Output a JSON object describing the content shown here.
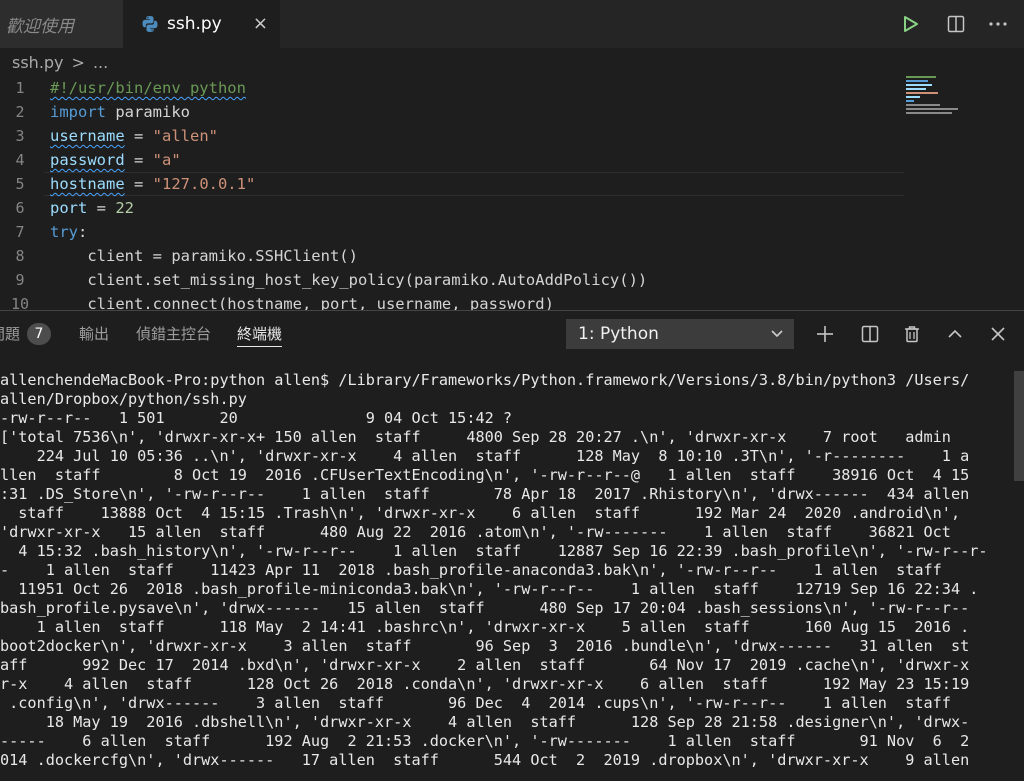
{
  "tabs": {
    "welcome_label": "歡迎使用",
    "active_label": "ssh.py",
    "close_symbol": "×"
  },
  "breadcrumb": {
    "file": "ssh.py",
    "separator": ">",
    "more": "..."
  },
  "editor": {
    "line_numbers": [
      "1",
      "2",
      "3",
      "4",
      "5",
      "6",
      "7",
      "8",
      "9",
      "10"
    ],
    "lines": [
      [
        {
          "t": "#!/usr/bin/env python",
          "c": "tk-comment",
          "s": true
        }
      ],
      [
        {
          "t": "import",
          "c": "tk-kw"
        },
        {
          "t": " paramiko",
          "c": ""
        }
      ],
      [
        {
          "t": "username",
          "c": "tk-var",
          "s": true
        },
        {
          "t": " = ",
          "c": ""
        },
        {
          "t": "\"allen\"",
          "c": "tk-str"
        }
      ],
      [
        {
          "t": "password",
          "c": "tk-var",
          "s": true
        },
        {
          "t": " = ",
          "c": ""
        },
        {
          "t": "\"a\"",
          "c": "tk-str"
        }
      ],
      [
        {
          "t": "hostname",
          "c": "tk-var",
          "s": true
        },
        {
          "t": " = ",
          "c": ""
        },
        {
          "t": "\"127.0.0.1\"",
          "c": "tk-str"
        }
      ],
      [
        {
          "t": "port",
          "c": "tk-var"
        },
        {
          "t": " = ",
          "c": ""
        },
        {
          "t": "22",
          "c": "tk-num"
        }
      ],
      [
        {
          "t": "try",
          "c": "tk-kw"
        },
        {
          "t": ":",
          "c": ""
        }
      ],
      [
        {
          "t": "    client = paramiko.SSHClient()",
          "c": ""
        }
      ],
      [
        {
          "t": "    client.set_missing_host_key_policy(paramiko.AutoAddPolicy())",
          "c": ""
        }
      ],
      [
        {
          "t": "    client.connect(hostname, port, username, password)",
          "c": ""
        }
      ]
    ]
  },
  "panel": {
    "problems_label": "問題",
    "problems_count": "7",
    "output_label": "輸出",
    "debug_console_label": "偵錯主控台",
    "terminal_label": "終端機",
    "terminal_select": "1: Python",
    "plus_symbol": "+",
    "close_symbol": "×"
  },
  "terminal": {
    "lines": [
      "allenchendeMacBook-Pro:python allen$ /Library/Frameworks/Python.framework/Versions/3.8/bin/python3 /Users/",
      "allen/Dropbox/python/ssh.py",
      "-rw-r--r--   1 501      20              9 04 Oct 15:42 ?",
      "['total 7536\\n', 'drwxr-xr-x+ 150 allen  staff     4800 Sep 28 20:27 .\\n', 'drwxr-xr-x    7 root   admin",
      "    224 Jul 10 05:36 ..\\n', 'drwxr-xr-x    4 allen  staff      128 May  8 10:10 .3T\\n', '-r--------    1 a",
      "llen  staff        8 Oct 19  2016 .CFUserTextEncoding\\n', '-rw-r--r--@   1 allen  staff    38916 Oct  4 15",
      ":31 .DS_Store\\n', '-rw-r--r--    1 allen  staff       78 Apr 18  2017 .Rhistory\\n', 'drwx------  434 allen",
      "  staff    13888 Oct  4 15:15 .Trash\\n', 'drwxr-xr-x    6 allen  staff      192 Mar 24  2020 .android\\n',",
      "'drwxr-xr-x   15 allen  staff      480 Aug 22  2016 .atom\\n', '-rw-------    1 allen  staff    36821 Oct",
      "  4 15:32 .bash_history\\n', '-rw-r--r--    1 allen  staff    12887 Sep 16 22:39 .bash_profile\\n', '-rw-r--r-",
      "-    1 allen  staff    11423 Apr 11  2018 .bash_profile-anaconda3.bak\\n', '-rw-r--r--    1 allen  staff",
      "  11951 Oct 26  2018 .bash_profile-miniconda3.bak\\n', '-rw-r--r--    1 allen  staff    12719 Sep 16 22:34 .",
      "bash_profile.pysave\\n', 'drwx------   15 allen  staff      480 Sep 17 20:04 .bash_sessions\\n', '-rw-r--r--",
      "    1 allen  staff      118 May  2 14:41 .bashrc\\n', 'drwxr-xr-x    5 allen  staff      160 Aug 15  2016 .",
      "boot2docker\\n', 'drwxr-xr-x    3 allen  staff       96 Sep  3  2016 .bundle\\n', 'drwx------   31 allen  st",
      "aff      992 Dec 17  2014 .bxd\\n', 'drwxr-xr-x    2 allen  staff       64 Nov 17  2019 .cache\\n', 'drwxr-x",
      "r-x    4 allen  staff      128 Oct 26  2018 .conda\\n', 'drwxr-xr-x    6 allen  staff      192 May 23 15:19",
      " .config\\n', 'drwx------    3 allen  staff       96 Dec  4  2014 .cups\\n', '-rw-r--r--    1 allen  staff",
      "     18 May 19  2016 .dbshell\\n', 'drwxr-xr-x    4 allen  staff      128 Sep 28 21:58 .designer\\n', 'drwx-",
      "-----    6 allen  staff      192 Aug  2 21:53 .docker\\n', '-rw-------    1 allen  staff       91 Nov  6  2",
      "014 .dockercfg\\n', 'drwx------   17 allen  staff      544 Oct  2  2019 .dropbox\\n', 'drwxr-xr-x    9 allen"
    ]
  },
  "colors": {
    "editor_bg": "#1e1e1e",
    "tabbar_bg": "#252526",
    "keyword": "#569cd6",
    "string": "#ce9178",
    "number": "#b5cea8",
    "comment": "#6a9955",
    "variable": "#9cdcfe",
    "run_green": "#89d185"
  },
  "icons": {
    "python_file": "python-icon",
    "run": "run-icon",
    "split": "split-editor-icon",
    "more": "more-actions-icon",
    "split_terminal": "split-terminal-icon",
    "trash": "trash-icon",
    "maximize": "chevron-up-icon",
    "close_panel": "close-icon"
  }
}
